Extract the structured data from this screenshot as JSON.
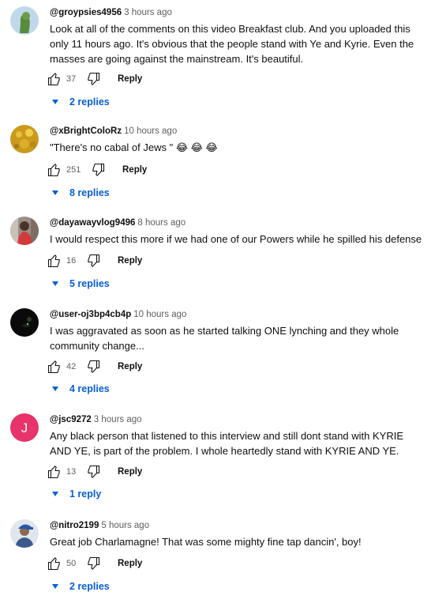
{
  "comments": [
    {
      "author": "@groypsies4956",
      "time": "3 hours ago",
      "text": "Look at all of the comments on this video Breakfast club. And you uploaded this only 11 hours ago. It's obvious that the people stand with Ye and Kyrie. Even the masses are going against the mainstream. It's beautiful.",
      "likes": "37",
      "reply_label": "Reply",
      "replies_label": "2 replies"
    },
    {
      "author": "@xBrightColoRz",
      "time": "10 hours ago",
      "text": "\"There's no cabal of Jews \" 😂 😂 😂",
      "likes": "251",
      "reply_label": "Reply",
      "replies_label": "8 replies"
    },
    {
      "author": "@dayawayvlog9496",
      "time": "8 hours ago",
      "text": "I would respect this more if we had one of our Powers while he spilled his defense",
      "likes": "16",
      "reply_label": "Reply",
      "replies_label": "5 replies"
    },
    {
      "author": "@user-oj3bp4cb4p",
      "time": "10 hours ago",
      "text": "I was aggravated as soon as he started talking ONE lynching and they whole community change...",
      "likes": "42",
      "reply_label": "Reply",
      "replies_label": "4 replies"
    },
    {
      "author": "@jsc9272",
      "time": "3 hours ago",
      "text": "Any black person that listened to this interview and still dont stand with KYRIE AND YE, is part of the problem. I whole heartedly stand with KYRIE AND YE.",
      "likes": "13",
      "reply_label": "Reply",
      "replies_label": "1 reply",
      "avatar_letter": "J"
    },
    {
      "author": "@nitro2199",
      "time": "5 hours ago",
      "text": "Great job Charlamagne! That was some mighty fine tap dancin', boy!",
      "likes": "50",
      "reply_label": "Reply",
      "replies_label": "2 replies"
    }
  ],
  "colors": {
    "link_blue": "#065fd4",
    "secondary_text": "#606060",
    "avatar_j_bg": "#e8336b"
  },
  "icons": [
    "thumbs-up-icon",
    "thumbs-down-icon",
    "caret-down-icon"
  ]
}
